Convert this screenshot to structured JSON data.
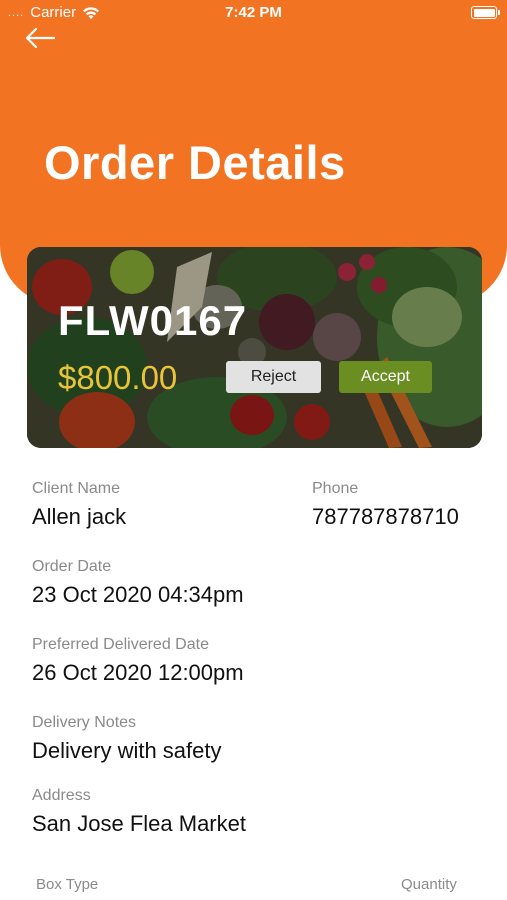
{
  "status_bar": {
    "signal": "....",
    "carrier": "Carrier",
    "time": "7:42 PM"
  },
  "header": {
    "title": "Order Details",
    "back_icon": "arrow-left-icon"
  },
  "order": {
    "id": "FLW0167",
    "price": "$800.00",
    "reject_label": "Reject",
    "accept_label": "Accept"
  },
  "details": {
    "client_name_label": "Client Name",
    "client_name": "Allen jack",
    "phone_label": "Phone",
    "phone": "787787878710",
    "order_date_label": "Order Date",
    "order_date": "23 Oct 2020 04:34pm",
    "preferred_date_label": "Preferred Delivered Date",
    "preferred_date": "26 Oct 2020 12:00pm",
    "notes_label": "Delivery Notes",
    "notes": "Delivery with safety",
    "address_label": "Address",
    "address": "San Jose Flea Market"
  },
  "box_table": {
    "box_type_label": "Box Type",
    "quantity_label": "Quantity"
  },
  "colors": {
    "header": "#f27423",
    "price": "#e8c43a",
    "accept": "#6b8e23",
    "reject": "#e2e2e2"
  }
}
